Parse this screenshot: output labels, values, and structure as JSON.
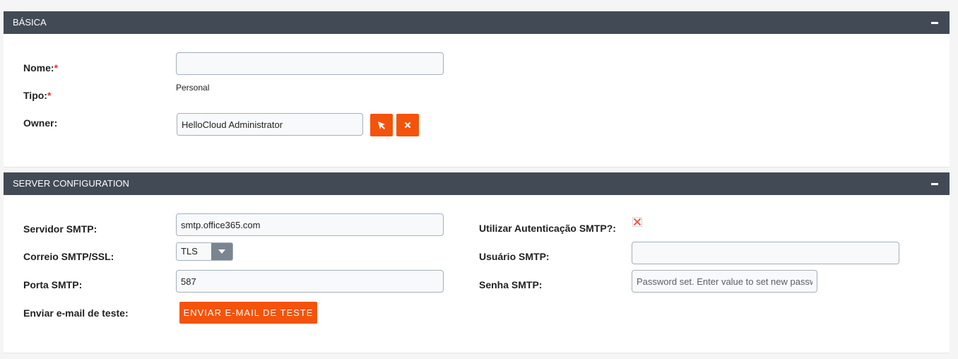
{
  "basic": {
    "header": "BÁSICA",
    "nome_label": "Nome:",
    "nome_value": "",
    "tipo_label": "Tipo:",
    "tipo_value": "Personal",
    "owner_label": "Owner:",
    "owner_value": "HelloCloud Administrator",
    "required_mark": "*"
  },
  "server": {
    "header": "SERVER CONFIGURATION",
    "smtp_server_label": "Servidor SMTP:",
    "smtp_server_value": "smtp.office365.com",
    "ssl_label": "Correio SMTP/SSL:",
    "ssl_value": "TLS",
    "port_label": "Porta SMTP:",
    "port_value": "587",
    "test_email_label": "Enviar e-mail de teste:",
    "test_email_button": "ENVIAR E-MAIL DE TESTE",
    "auth_label": "Utilizar Autenticação SMTP?:",
    "auth_checked": true,
    "user_label": "Usuário SMTP:",
    "user_value": "",
    "password_label": "Senha SMTP:",
    "password_placeholder": "Password set. Enter value to set new password"
  },
  "icons": {
    "collapse": "minus-icon",
    "select": "cursor-select-icon",
    "clear": "close-icon",
    "dropdown": "caret-down-icon",
    "checkbox": "checkbox-x-icon"
  },
  "colors": {
    "header_bg": "#424b55",
    "accent": "#f4530b",
    "required": "#e8322b"
  }
}
